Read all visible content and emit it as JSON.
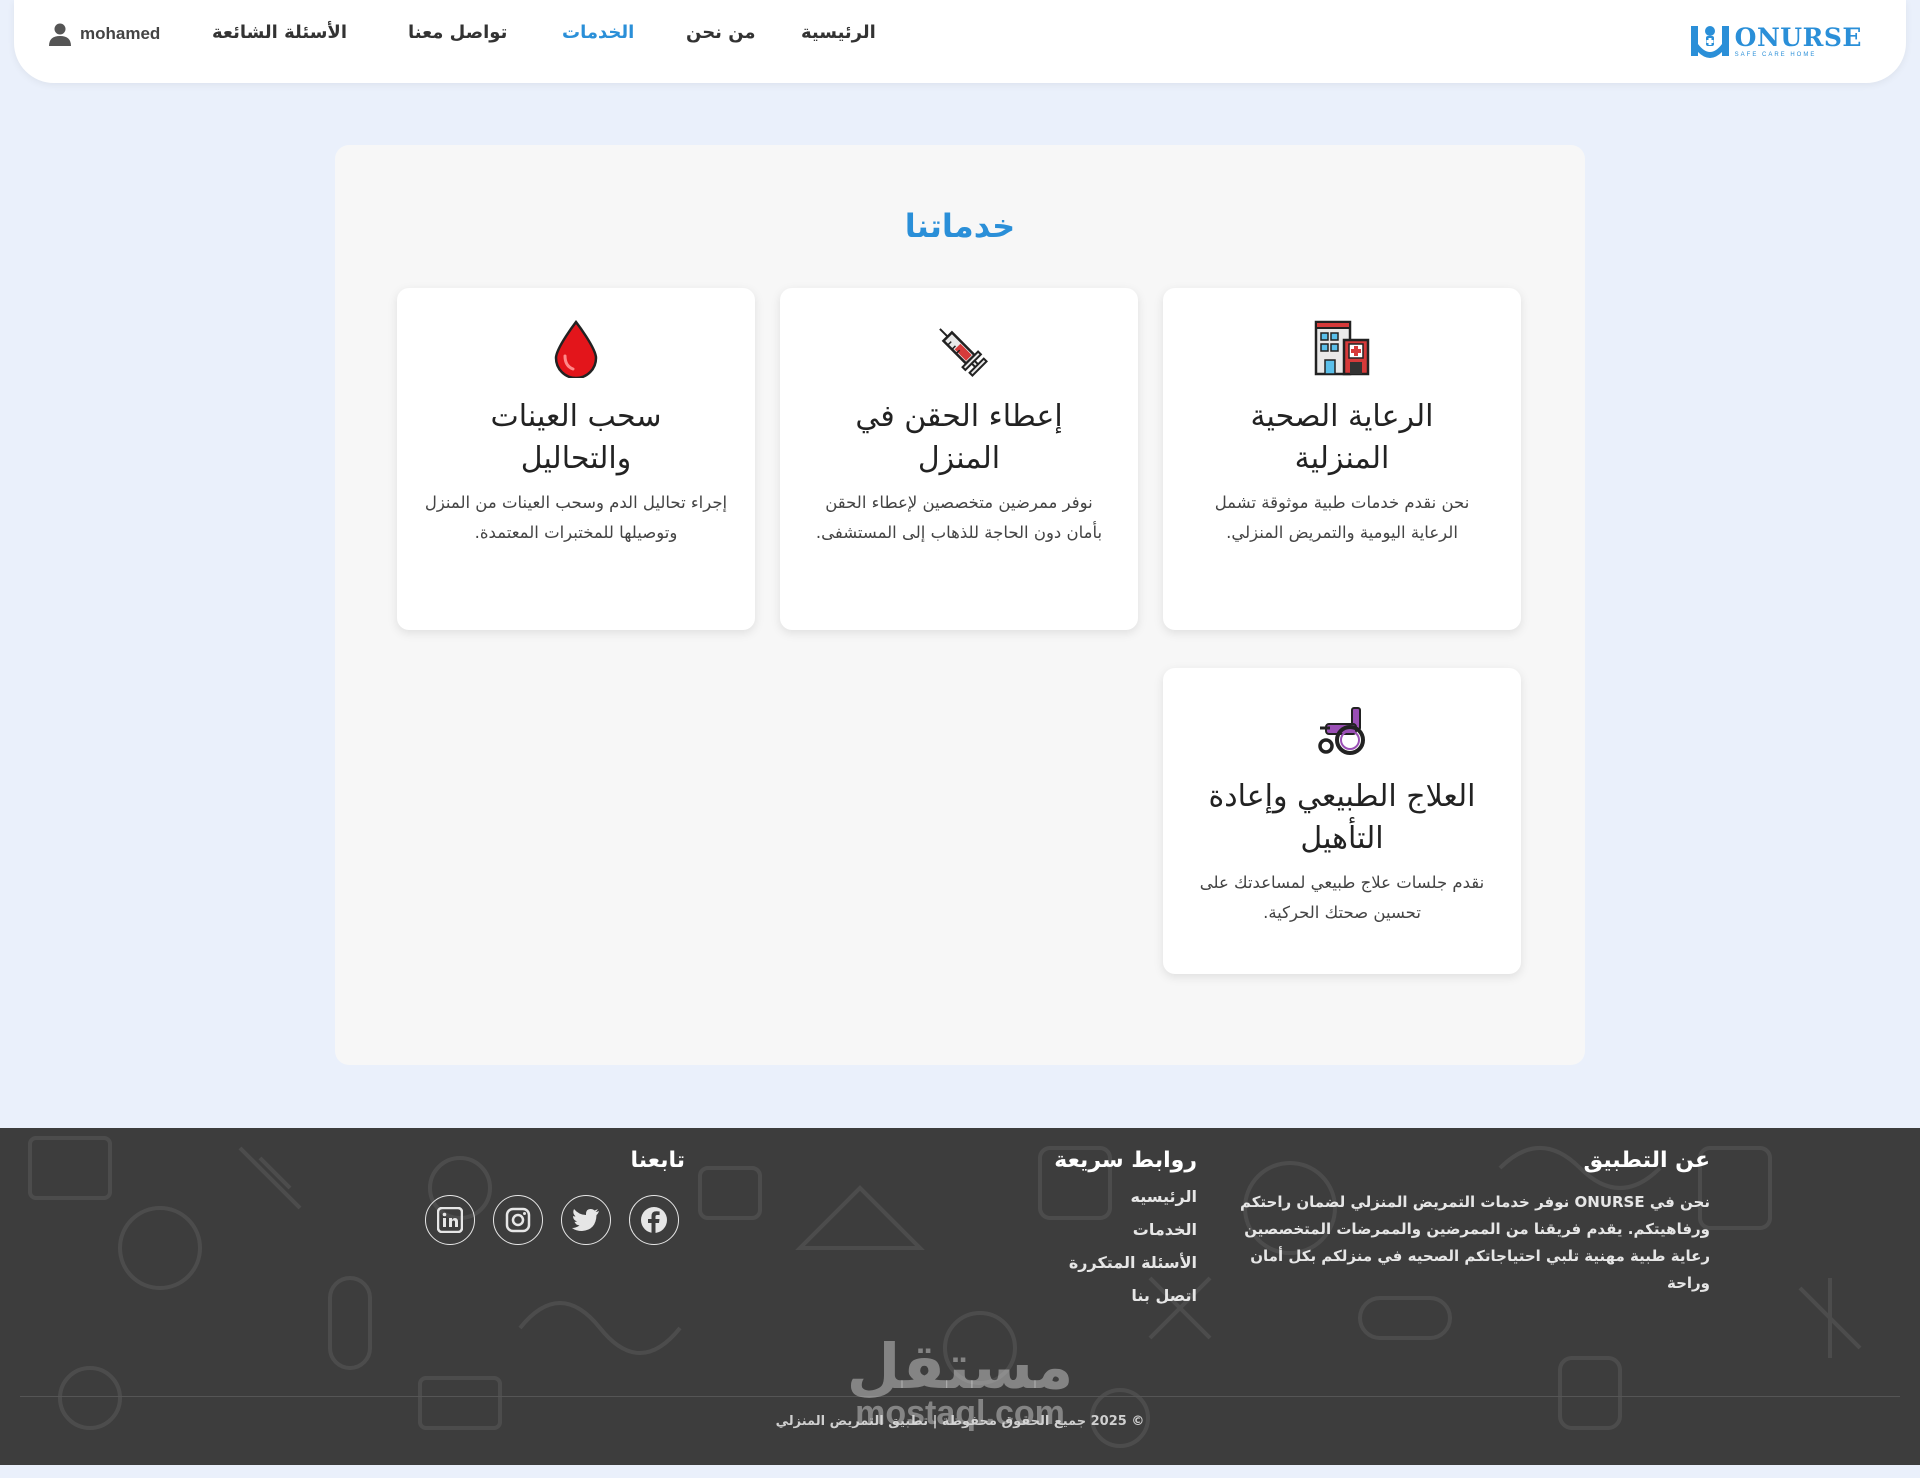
{
  "brand": {
    "name": "ONURSE",
    "tagline": "SAFE CARE HOME"
  },
  "nav": {
    "items": [
      {
        "label": "الرئيسية"
      },
      {
        "label": "من نحن"
      },
      {
        "label": "الخدمات",
        "active": true
      },
      {
        "label": "تواصل معنا"
      },
      {
        "label": "الأسئلة الشائعة"
      }
    ],
    "user_name": "mohamed"
  },
  "services": {
    "title": "خدماتنا",
    "cards": [
      {
        "icon": "hospital-icon",
        "title": "الرعاية الصحية المنزلية",
        "desc": "نحن نقدم خدمات طبية موثوقة تشمل الرعاية اليومية والتمريض المنزلي."
      },
      {
        "icon": "syringe-icon",
        "title": "إعطاء الحقن في المنزل",
        "desc": "نوفر ممرضين متخصصين لإعطاء الحقن بأمان دون الحاجة للذهاب إلى المستشفى."
      },
      {
        "icon": "blood-drop-icon",
        "title": "سحب العينات والتحاليل",
        "desc": "إجراء تحاليل الدم وسحب العينات من المنزل وتوصيلها للمختبرات المعتمدة."
      },
      {
        "icon": "wheelchair-icon",
        "title": "العلاج الطبيعي وإعادة التأهيل",
        "desc": "نقدم جلسات علاج طبيعي لمساعدتك على تحسين صحتك الحركية."
      }
    ]
  },
  "footer": {
    "about": {
      "heading": "عن التطبيق",
      "text": "نحن في ONURSE نوفر خدمات التمريض المنزلي لضمان راحتكم ورفاهيتكم. يقدم فريقنا من الممرضين والممرضات المتخصصين رعاية طبية مهنية تلبي احتياجاتكم الصحيه في منزلكم بكل أمان وراحة"
    },
    "quick_links": {
      "heading": "روابط سريعة",
      "links": [
        "الرئيسيه",
        "الخدمات",
        "الأسئلة المتكررة",
        "اتصل بنا"
      ]
    },
    "follow": {
      "heading": "تابعنا",
      "socials": [
        "facebook-icon",
        "twitter-icon",
        "instagram-icon",
        "linkedin-icon"
      ]
    },
    "copyright": "© 2025 جميع الحقوق محفوظة | تطبيق التمريض المنزلي"
  },
  "watermark": {
    "arabic": "مستقل",
    "latin": "mostaql.com"
  },
  "colors": {
    "accent": "#2a8fd8",
    "page_bg": "#eaf0fb",
    "panel_bg": "#f7f7f7",
    "footer_bg": "#3d3d3d"
  }
}
